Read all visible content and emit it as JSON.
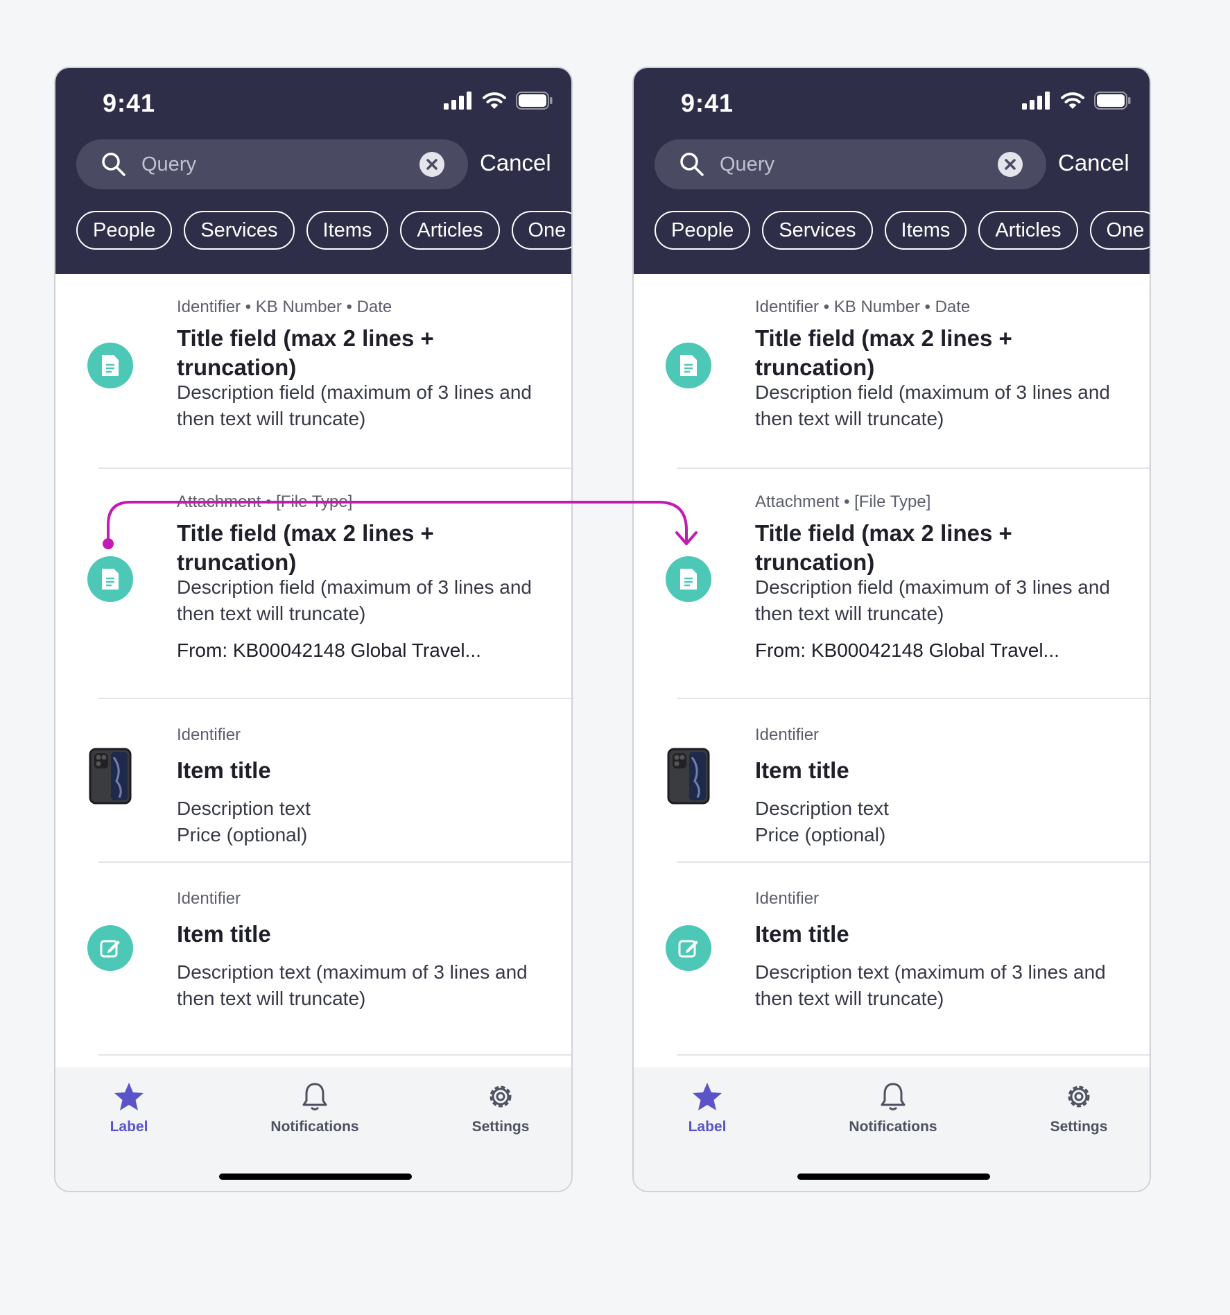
{
  "status": {
    "time": "9:41"
  },
  "search": {
    "placeholder": "Query",
    "cancel_label": "Cancel"
  },
  "chips": [
    "People",
    "Services",
    "Items",
    "Articles",
    "One"
  ],
  "results": {
    "kb": {
      "meta": "Identifier • KB Number • Date",
      "title": "Title field (max 2 lines + truncation)",
      "description": "Description field (maximum of 3 lines and then text will truncate)"
    },
    "attachment": {
      "meta": "Attachment • [File Type]",
      "title": "Title field (max 2 lines + truncation)",
      "description": "Description field (maximum of 3 lines and then text will truncate)",
      "from": "From: KB00042148 Global Travel..."
    },
    "item": {
      "meta": "Identifier",
      "title": "Item title",
      "description": "Description text",
      "price": "Price (optional)"
    },
    "task": {
      "meta": "Identifier",
      "title": "Item title",
      "description": "Description text (maximum of 3 lines and then text will truncate)"
    }
  },
  "tabs": [
    {
      "label": "Label",
      "icon": "star-icon",
      "active": true
    },
    {
      "label": "Notifications",
      "icon": "bell-icon",
      "active": false
    },
    {
      "label": "Settings",
      "icon": "gear-icon",
      "active": false
    }
  ],
  "colors": {
    "header": "#2e2e48",
    "accent": "#5b54c8",
    "icon_teal": "#4dc7b6",
    "connector": "#c41ab3"
  }
}
